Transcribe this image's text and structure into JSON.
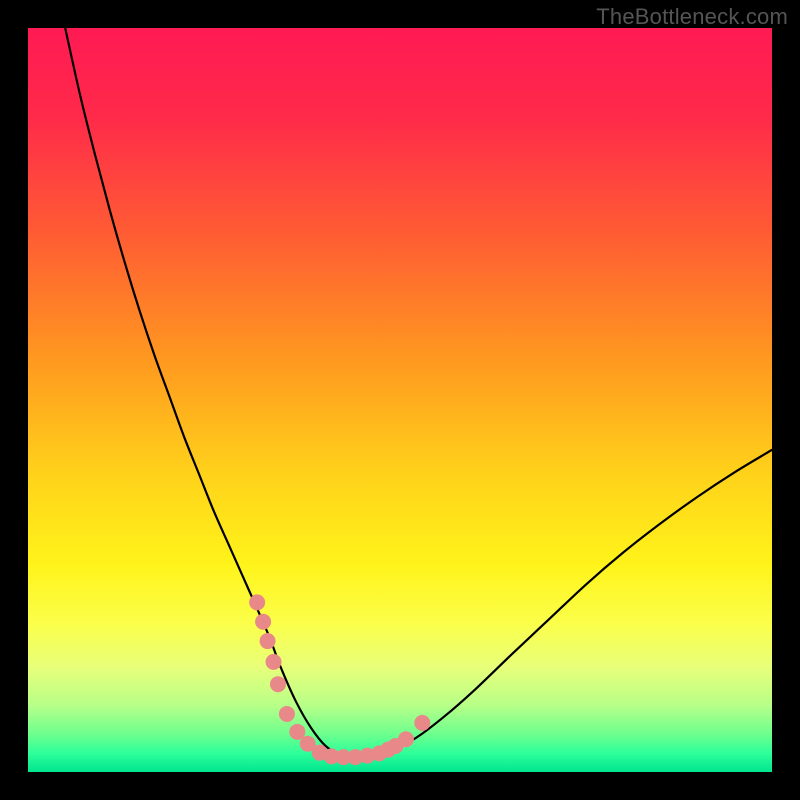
{
  "watermark": "TheBottleneck.com",
  "chart_data": {
    "type": "line",
    "title": "",
    "xlabel": "",
    "ylabel": "",
    "xlim": [
      0,
      100
    ],
    "ylim": [
      0,
      100
    ],
    "gradient_stops": [
      {
        "offset": 0.0,
        "color": "#ff1a53"
      },
      {
        "offset": 0.12,
        "color": "#ff2a4a"
      },
      {
        "offset": 0.28,
        "color": "#ff5d33"
      },
      {
        "offset": 0.45,
        "color": "#ff9a1f"
      },
      {
        "offset": 0.6,
        "color": "#ffd21a"
      },
      {
        "offset": 0.72,
        "color": "#fff31a"
      },
      {
        "offset": 0.8,
        "color": "#fbff4a"
      },
      {
        "offset": 0.86,
        "color": "#e7ff7a"
      },
      {
        "offset": 0.91,
        "color": "#b8ff88"
      },
      {
        "offset": 0.95,
        "color": "#6bff8e"
      },
      {
        "offset": 0.975,
        "color": "#2dff9a"
      },
      {
        "offset": 1.0,
        "color": "#00e58f"
      }
    ],
    "series": [
      {
        "name": "bottleneck-curve",
        "color": "#000000",
        "width": 2.2,
        "x": [
          5,
          7,
          9,
          11,
          13,
          15,
          17,
          19,
          21,
          23,
          25,
          27,
          29,
          31,
          32.5,
          34,
          36,
          38,
          40,
          42,
          44,
          48,
          52,
          56,
          60,
          65,
          70,
          75,
          80,
          85,
          90,
          95,
          100
        ],
        "y": [
          100,
          91,
          83,
          75.5,
          68.5,
          62,
          56,
          50.5,
          45,
          40,
          35,
          30.5,
          26,
          21.5,
          18,
          14,
          9.5,
          6,
          3.5,
          2.3,
          2.0,
          2.6,
          4.5,
          7.5,
          11,
          15.8,
          20.5,
          25.2,
          29.5,
          33.4,
          37,
          40.3,
          43.3
        ]
      }
    ],
    "markers": {
      "color": "#e98888",
      "radius": 8,
      "points": [
        {
          "x": 30.8,
          "y": 22.8
        },
        {
          "x": 31.6,
          "y": 20.2
        },
        {
          "x": 32.2,
          "y": 17.6
        },
        {
          "x": 33.0,
          "y": 14.8
        },
        {
          "x": 33.6,
          "y": 11.8
        },
        {
          "x": 34.8,
          "y": 7.8
        },
        {
          "x": 36.2,
          "y": 5.4
        },
        {
          "x": 37.6,
          "y": 3.8
        },
        {
          "x": 39.2,
          "y": 2.6
        },
        {
          "x": 40.8,
          "y": 2.1
        },
        {
          "x": 42.4,
          "y": 2.0
        },
        {
          "x": 44.0,
          "y": 2.0
        },
        {
          "x": 45.6,
          "y": 2.2
        },
        {
          "x": 47.2,
          "y": 2.5
        },
        {
          "x": 48.4,
          "y": 3.0
        },
        {
          "x": 49.4,
          "y": 3.5
        },
        {
          "x": 50.8,
          "y": 4.4
        },
        {
          "x": 53.0,
          "y": 6.6
        }
      ]
    }
  }
}
